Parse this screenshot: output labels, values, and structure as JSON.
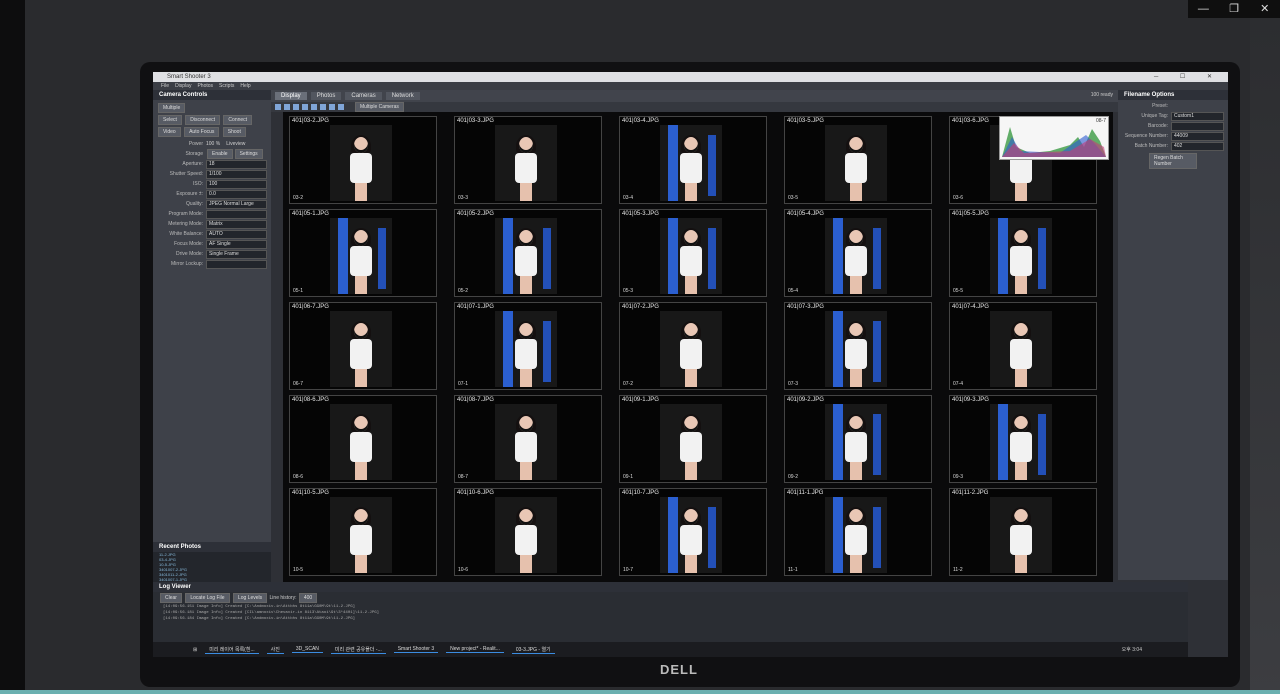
{
  "window": {
    "minimize": "—",
    "restore": "❐",
    "close": "✕"
  },
  "app": {
    "title": "Smart Shooter 3",
    "menu": [
      "File",
      "Display",
      "Photos",
      "Scripts",
      "Help"
    ],
    "tabs": [
      "Display",
      "Photos",
      "Cameras",
      "Network"
    ],
    "status": "100 ready",
    "camera_select": "Multiple Cameras"
  },
  "camera_controls": {
    "header": "Camera Controls",
    "multiple_label": "Multiple",
    "buttons": [
      "Select",
      "Disconnect",
      "Connect",
      "Video",
      "Auto Focus",
      "Shoot"
    ],
    "power_label": "Power",
    "power_value": "100 %",
    "liveview_label": "Liveview",
    "enable_label": "Enable",
    "storage_label": "Storage",
    "settings_label": "Settings",
    "fields": [
      {
        "label": "Aperture:",
        "value": "18"
      },
      {
        "label": "Shutter Speed:",
        "value": "1/100"
      },
      {
        "label": "ISO:",
        "value": "100"
      },
      {
        "label": "Exposure ±:",
        "value": "0.0"
      },
      {
        "label": "Quality:",
        "value": "JPEG Normal Large"
      },
      {
        "label": "Program Mode:",
        "value": ""
      },
      {
        "label": "Metering Mode:",
        "value": "Matrix"
      },
      {
        "label": "White Balance:",
        "value": "AUTO"
      },
      {
        "label": "Focus Mode:",
        "value": "AF Single"
      },
      {
        "label": "Drive Mode:",
        "value": "Single Frame"
      },
      {
        "label": "Mirror Lockup:",
        "value": ""
      }
    ]
  },
  "recent_photos": {
    "header": "Recent Photos",
    "items": [
      "11-2.JPG",
      "03-4.JPG",
      "10-5.JPG",
      "3401007-2.JPG",
      "3401011-2.JPG",
      "3401007-1.JPG",
      "3401003-2.JPG",
      "3401005-2.JPG",
      "3401009-2.JPG"
    ]
  },
  "filename_options": {
    "header": "Filename Options",
    "preset_label": "Preset:",
    "unique_tag_label": "Unique Tag:",
    "unique_tag_value": "Custom1",
    "barcode_label": "Barcode:",
    "sequence_label": "Sequence Number:",
    "sequence_value": "44009",
    "batch_label": "Batch Number:",
    "batch_value": "402",
    "regen_button": "Regen Batch Number"
  },
  "photos": [
    {
      "file": "401|03-2.JPG",
      "cap": "03-2",
      "blue": false
    },
    {
      "file": "401|03-3.JPG",
      "cap": "03-3",
      "blue": false
    },
    {
      "file": "401|03-4.JPG",
      "cap": "03-4",
      "blue": true
    },
    {
      "file": "401|03-5.JPG",
      "cap": "03-5",
      "blue": false
    },
    {
      "file": "401|03-6.JPG",
      "cap": "03-6",
      "blue": false
    },
    {
      "file": "401|05-1.JPG",
      "cap": "05-1",
      "blue": true
    },
    {
      "file": "401|05-2.JPG",
      "cap": "05-2",
      "blue": true
    },
    {
      "file": "401|05-3.JPG",
      "cap": "05-3",
      "blue": true
    },
    {
      "file": "401|05-4.JPG",
      "cap": "05-4",
      "blue": true
    },
    {
      "file": "401|05-5.JPG",
      "cap": "05-5",
      "blue": true
    },
    {
      "file": "401|06-7.JPG",
      "cap": "06-7",
      "blue": false
    },
    {
      "file": "401|07-1.JPG",
      "cap": "07-1",
      "blue": true
    },
    {
      "file": "401|07-2.JPG",
      "cap": "07-2",
      "blue": false
    },
    {
      "file": "401|07-3.JPG",
      "cap": "07-3",
      "blue": true
    },
    {
      "file": "401|07-4.JPG",
      "cap": "07-4",
      "blue": false
    },
    {
      "file": "401|08-6.JPG",
      "cap": "08-6",
      "blue": false
    },
    {
      "file": "401|08-7.JPG",
      "cap": "08-7",
      "blue": false
    },
    {
      "file": "401|09-1.JPG",
      "cap": "09-1",
      "blue": false
    },
    {
      "file": "401|09-2.JPG",
      "cap": "09-2",
      "blue": true
    },
    {
      "file": "401|09-3.JPG",
      "cap": "09-3",
      "blue": true
    },
    {
      "file": "401|10-5.JPG",
      "cap": "10-5",
      "blue": false
    },
    {
      "file": "401|10-6.JPG",
      "cap": "10-6",
      "blue": false
    },
    {
      "file": "401|10-7.JPG",
      "cap": "10-7",
      "blue": true
    },
    {
      "file": "401|11-1.JPG",
      "cap": "11-1",
      "blue": true
    },
    {
      "file": "401|11-2.JPG",
      "cap": "11-2",
      "blue": false
    }
  ],
  "histogram_label": "08-7",
  "log_viewer": {
    "header": "Log Viewer",
    "buttons": [
      "Clear",
      "Locate Log File",
      "Log Levels"
    ],
    "history_label": "Line history:",
    "history_value": "400",
    "lines": [
      "[14:09:56.151   Image   Info] Created [C:\\Andmoxiv-in\\Attbhs 8t11a\\GG0M\\9t\\11-2.JPG]",
      "[14:09:56.181   Image   Info] Created [CIL\\amnoxiv\\Chevavir-in 8113\\Ataoi\\9t\\3*4401]\\11-2.JPG]",
      "[14:09:56.184   Image   Info] Created [C:\\Andmoxiv-in\\Attbhs 8t11a\\GG0M\\9t\\11-2.JPG]"
    ]
  },
  "taskbar": {
    "items": [
      "미리 레이어 목록(흰...",
      "사진",
      "3D_SCAN",
      "미리 관련 공유폴더 -...",
      "Smart Shooter 3",
      "New project* - Realit...",
      "03-3.JPG - 열기"
    ],
    "clock": "오후 3:04"
  },
  "monitor_brand": "DELL"
}
